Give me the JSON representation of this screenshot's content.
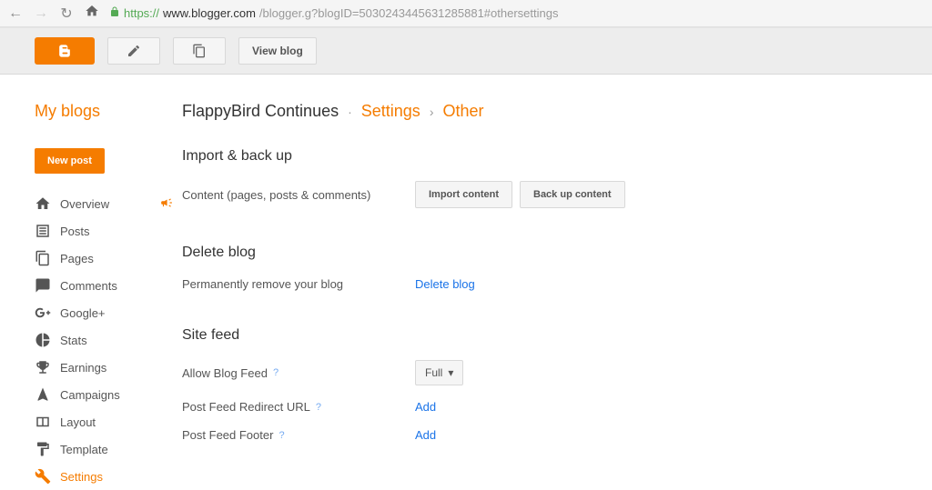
{
  "browser": {
    "url_protocol": "https://",
    "url_domain": "www.blogger.com",
    "url_path": "/blogger.g?blogID=5030243445631285881#othersettings"
  },
  "toolbar": {
    "view_blog_label": "View blog"
  },
  "header": {
    "my_blogs": "My blogs",
    "breadcrumb": {
      "blog_name": "FlappyBird Continues",
      "section": "Settings",
      "subsection": "Other"
    }
  },
  "sidebar": {
    "new_post_label": "New post",
    "items": [
      {
        "label": "Overview"
      },
      {
        "label": "Posts"
      },
      {
        "label": "Pages"
      },
      {
        "label": "Comments"
      },
      {
        "label": "Google+"
      },
      {
        "label": "Stats"
      },
      {
        "label": "Earnings"
      },
      {
        "label": "Campaigns"
      },
      {
        "label": "Layout"
      },
      {
        "label": "Template"
      },
      {
        "label": "Settings"
      }
    ]
  },
  "sections": {
    "import_backup": {
      "title": "Import & back up",
      "content_label": "Content (pages, posts & comments)",
      "import_btn": "Import content",
      "backup_btn": "Back up content"
    },
    "delete_blog": {
      "title": "Delete blog",
      "label": "Permanently remove your blog",
      "link": "Delete blog"
    },
    "site_feed": {
      "title": "Site feed",
      "allow_label": "Allow Blog Feed",
      "allow_value": "Full",
      "redirect_label": "Post Feed Redirect URL",
      "redirect_link": "Add",
      "footer_label": "Post Feed Footer",
      "footer_link": "Add"
    }
  }
}
